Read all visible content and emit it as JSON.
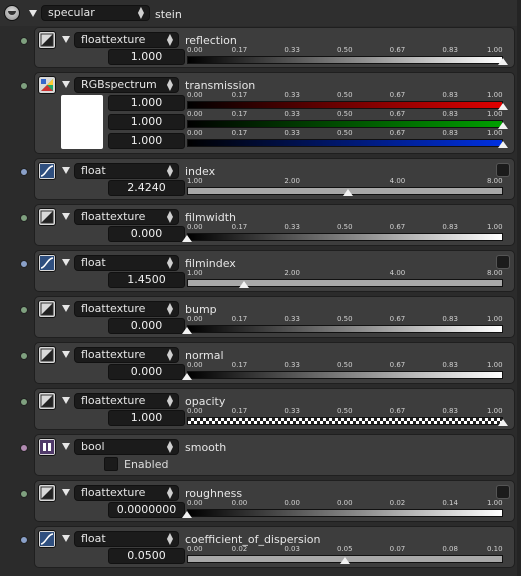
{
  "header": {
    "material_type": "specular",
    "material_name": "stein"
  },
  "rows": [
    {
      "label": "reflection",
      "type": "floattexture",
      "value": "1.000",
      "ticks": [
        "0.00",
        "0.17",
        "0.33",
        "0.50",
        "0.67",
        "0.83",
        "1.00"
      ],
      "level": 1.0,
      "bar": "gradient",
      "icon": "texture-icon",
      "socket_color": "#7fa07f",
      "has_curve": false
    },
    {
      "label": "transmission",
      "type": "RGBspectrum",
      "values": [
        "1.000",
        "1.000",
        "1.000"
      ],
      "ticks": [
        "0.00",
        "0.17",
        "0.33",
        "0.50",
        "0.67",
        "0.83",
        "1.00"
      ],
      "level": 1.0,
      "bars": [
        "red",
        "green",
        "blue"
      ],
      "icon": "rgb-spectrum-icon",
      "socket_color": "#7fa07f",
      "swatch_color": "#ffffff"
    },
    {
      "label": "index",
      "type": "float",
      "value": "2.4240",
      "ticks": [
        "1.00",
        "2.00",
        "4.00",
        "8.00"
      ],
      "level": 0.51,
      "bar": "flat",
      "icon": "float-curve-icon",
      "socket_color": "#8aa0c8",
      "has_curve": true
    },
    {
      "label": "filmwidth",
      "type": "floattexture",
      "value": "0.000",
      "ticks": [
        "0.00",
        "0.17",
        "0.33",
        "0.50",
        "0.67",
        "0.83",
        "1.00"
      ],
      "level": 0.0,
      "bar": "gradient",
      "icon": "texture-icon",
      "socket_color": "#7fa07f",
      "has_curve": false
    },
    {
      "label": "filmindex",
      "type": "float",
      "value": "1.4500",
      "ticks": [
        "1.00",
        "2.00",
        "4.00",
        "8.00"
      ],
      "level": 0.18,
      "bar": "flat",
      "icon": "float-curve-icon",
      "socket_color": "#8aa0c8",
      "has_curve": true
    },
    {
      "label": "bump",
      "type": "floattexture",
      "value": "0.000",
      "ticks": [
        "0.00",
        "0.17",
        "0.33",
        "0.50",
        "0.67",
        "0.83",
        "1.00"
      ],
      "level": 0.0,
      "bar": "gradient",
      "icon": "texture-icon",
      "socket_color": "#7fa07f",
      "has_curve": false
    },
    {
      "label": "normal",
      "type": "floattexture",
      "value": "0.000",
      "ticks": [
        "0.00",
        "0.17",
        "0.33",
        "0.50",
        "0.67",
        "0.83",
        "1.00"
      ],
      "level": 0.0,
      "bar": "gradient",
      "icon": "texture-icon",
      "socket_color": "#7fa07f",
      "has_curve": false
    },
    {
      "label": "opacity",
      "type": "floattexture",
      "value": "1.000",
      "ticks": [
        "0.00",
        "0.17",
        "0.33",
        "0.50",
        "0.67",
        "0.83",
        "1.00"
      ],
      "level": 1.0,
      "bar": "checker",
      "icon": "texture-icon",
      "socket_color": "#7fa07f",
      "has_curve": false
    },
    {
      "label": "smooth",
      "type": "bool",
      "check_label": "Enabled",
      "icon": "bool-icon",
      "socket_color": "#b08ab0"
    },
    {
      "label": "roughness",
      "type": "floattexture",
      "value": "0.0000000",
      "ticks": [
        "0.00",
        "0.00",
        "0.00",
        "0.00",
        "0.02",
        "0.14",
        "1.00"
      ],
      "level": 0.0,
      "bar": "gradient",
      "icon": "texture-icon",
      "socket_color": "#7fa07f",
      "has_curve": true
    },
    {
      "label": "coefficient_of_dispersion",
      "type": "float",
      "value": "0.0500",
      "ticks": [
        "0.00",
        "0.02",
        "0.03",
        "0.05",
        "0.07",
        "0.08",
        "0.10"
      ],
      "level": 0.5,
      "bar": "flat",
      "icon": "float-curve-icon",
      "socket_color": "#8aa0c8",
      "has_curve": false
    }
  ]
}
